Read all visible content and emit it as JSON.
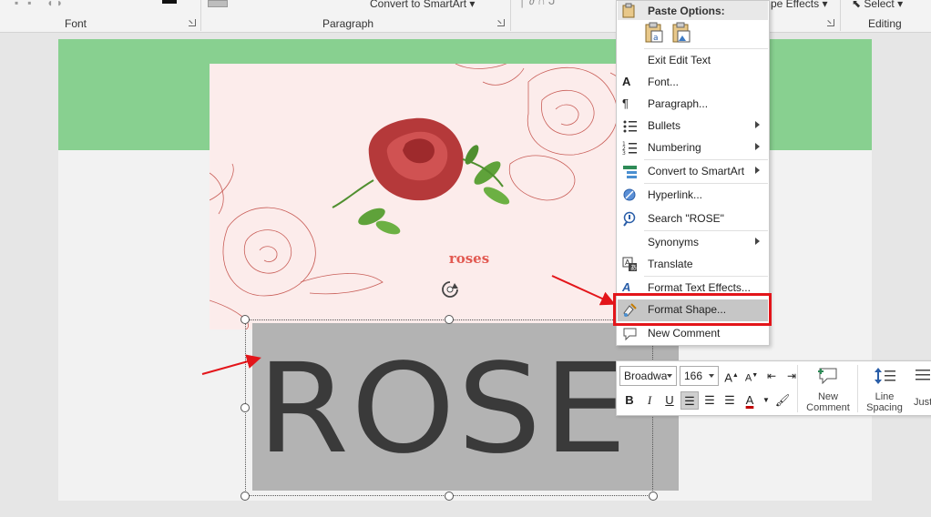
{
  "ribbon": {
    "groups": {
      "font": "Font",
      "paragraph": "Paragraph",
      "editing": "Editing"
    },
    "convert_to_smartart": "Convert to SmartArt",
    "shape_effects_partial": "pe Effects",
    "select": "Select"
  },
  "slide": {
    "card_title": "roses",
    "textbox_text": "ROSE",
    "colors": {
      "band": "#88d090",
      "card": "#fceceb",
      "textbox": "#b3b3b3",
      "text": "#3a3a3a"
    }
  },
  "context_menu": {
    "paste_header": "Paste Options:",
    "items": [
      {
        "label": "Exit Edit Text",
        "icon": "exit-edit-icon"
      },
      {
        "label": "Font...",
        "icon": "font-a-icon"
      },
      {
        "label": "Paragraph...",
        "icon": "paragraph-icon"
      },
      {
        "label": "Bullets",
        "icon": "bullets-icon",
        "submenu": true
      },
      {
        "label": "Numbering",
        "icon": "numbering-icon",
        "submenu": true
      },
      {
        "label": "Convert to SmartArt",
        "icon": "smartart-icon",
        "submenu": true
      },
      {
        "label": "Hyperlink...",
        "icon": "hyperlink-icon"
      },
      {
        "label": "Search \"ROSE\"",
        "icon": "search-icon"
      },
      {
        "label": "Synonyms",
        "icon": "synonyms-icon",
        "submenu": true
      },
      {
        "label": "Translate",
        "icon": "translate-icon"
      },
      {
        "label": "Format Text Effects...",
        "icon": "text-effects-icon"
      },
      {
        "label": "Format Shape...",
        "icon": "format-shape-icon",
        "highlighted": true
      },
      {
        "label": "New Comment",
        "icon": "comment-icon"
      }
    ]
  },
  "mini_toolbar": {
    "font_name": "Broadwa",
    "font_size": "166",
    "new_comment": [
      "New",
      "Comment"
    ],
    "line_spacing": [
      "Line",
      "Spacing"
    ],
    "justify_partial": "Justi"
  },
  "annotation": {
    "highlight_color": "#e3151a"
  }
}
